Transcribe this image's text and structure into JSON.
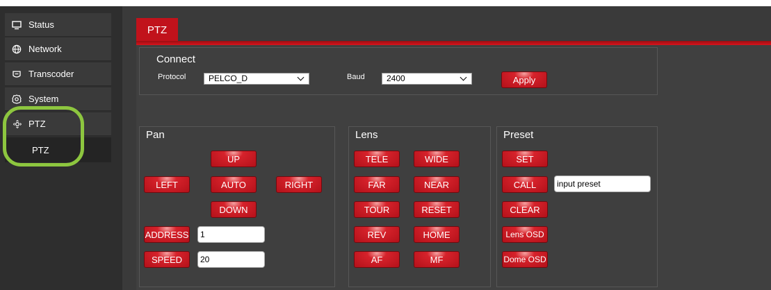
{
  "sidebar": {
    "items": [
      {
        "label": "Status",
        "icon": "monitor-icon"
      },
      {
        "label": "Network",
        "icon": "globe-icon"
      },
      {
        "label": "Transcoder",
        "icon": "transcoder-icon"
      },
      {
        "label": "System",
        "icon": "gear-icon"
      },
      {
        "label": "PTZ",
        "icon": "ptz-icon"
      }
    ],
    "sub_items": [
      {
        "label": "PTZ"
      }
    ],
    "highlight_color": "#8dc63f"
  },
  "tabs": {
    "active": "PTZ",
    "accent": "#c1121b"
  },
  "connect": {
    "legend": "Connect",
    "protocol_label": "Protocol",
    "protocol_value": "PELCO_D",
    "baud_label": "Baud",
    "baud_value": "2400",
    "apply_label": "Apply"
  },
  "pan": {
    "legend": "Pan",
    "up": "UP",
    "left": "LEFT",
    "auto": "AUTO",
    "right": "RIGHT",
    "down": "DOWN",
    "address_label": "ADDRESS",
    "address_value": "1",
    "speed_label": "SPEED",
    "speed_value": "20"
  },
  "lens": {
    "legend": "Lens",
    "tele": "TELE",
    "wide": "WIDE",
    "far": "FAR",
    "near": "NEAR",
    "tour": "TOUR",
    "reset": "RESET",
    "rev": "REV",
    "home": "HOME",
    "af": "AF",
    "mf": "MF"
  },
  "preset": {
    "legend": "Preset",
    "set": "SET",
    "call": "CALL",
    "input_value": "input preset",
    "clear": "CLEAR",
    "lens_osd": "Lens OSD",
    "dome_osd": "Dome OSD"
  }
}
